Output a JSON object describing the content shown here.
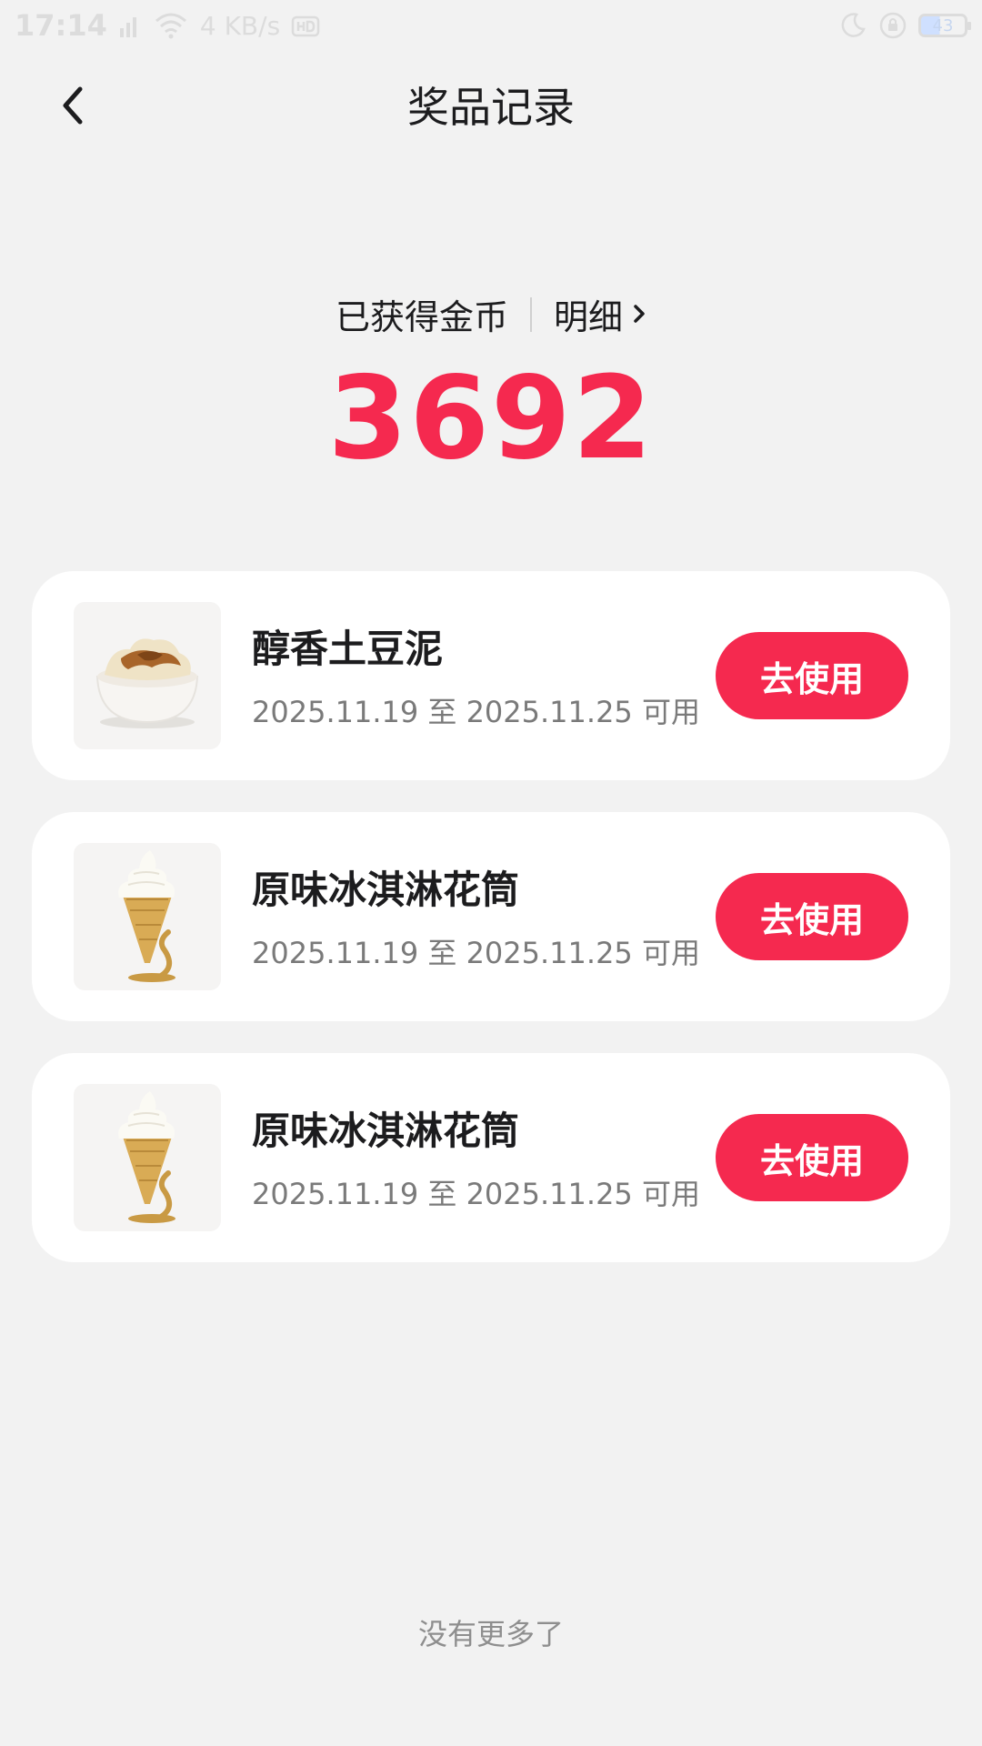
{
  "status_bar": {
    "time": "17:14",
    "network_speed": "4 KB/s",
    "battery": "43"
  },
  "header": {
    "title": "奖品记录"
  },
  "coins": {
    "label": "已获得金币",
    "detail_label": "明细",
    "value": "3692"
  },
  "prizes": [
    {
      "name": "醇香土豆泥",
      "validity": "2025.11.19 至 2025.11.25 可用",
      "button": "去使用",
      "image": "mashed-potato-bowl"
    },
    {
      "name": "原味冰淇淋花筒",
      "validity": "2025.11.19 至 2025.11.25 可用",
      "button": "去使用",
      "image": "ice-cream-cone"
    },
    {
      "name": "原味冰淇淋花筒",
      "validity": "2025.11.19 至 2025.11.25 可用",
      "button": "去使用",
      "image": "ice-cream-cone"
    }
  ],
  "footer": {
    "end_text": "没有更多了"
  },
  "colors": {
    "accent": "#f5294f",
    "background": "#f2f2f2",
    "card": "#ffffff"
  }
}
